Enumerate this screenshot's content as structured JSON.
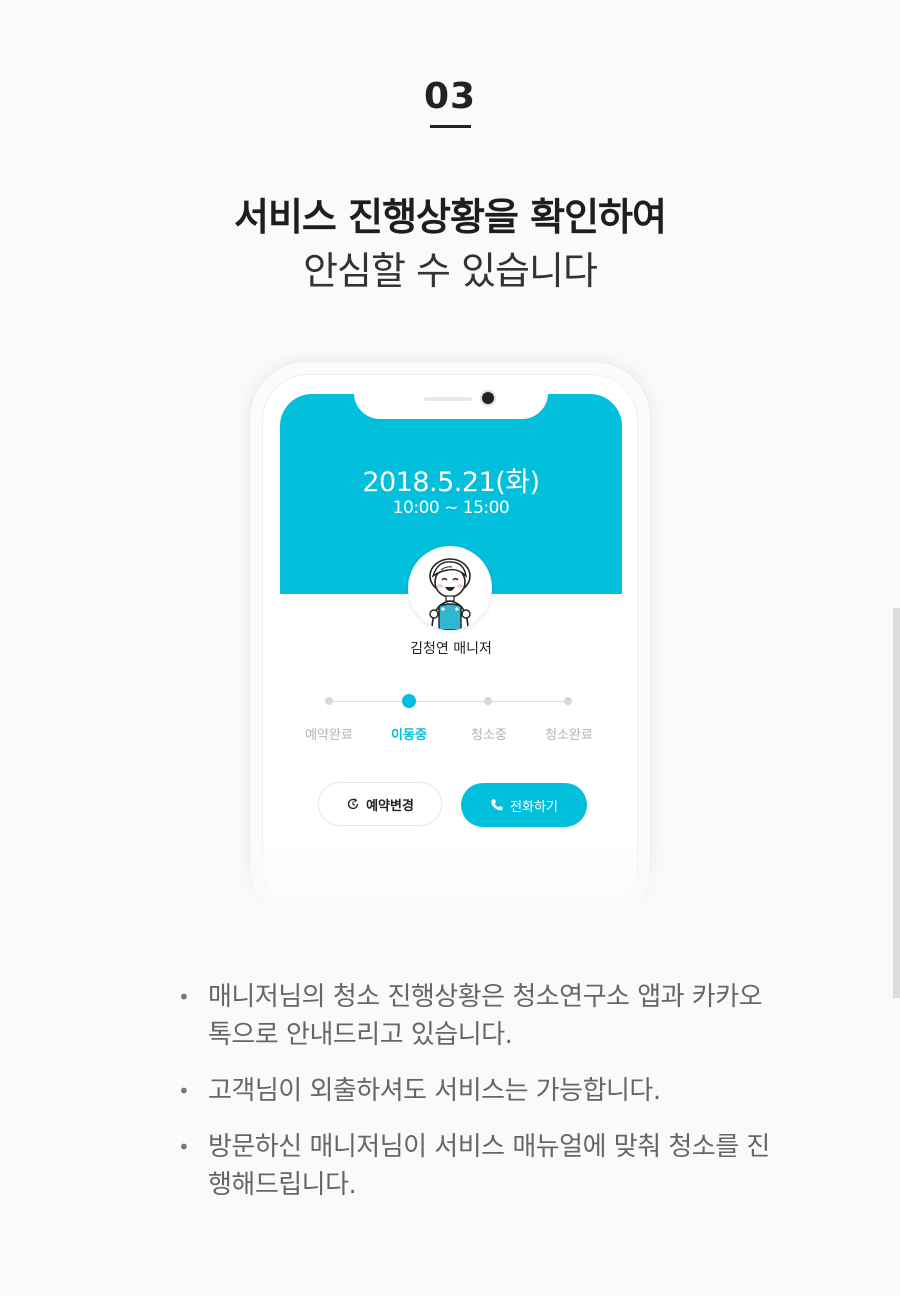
{
  "step": {
    "number": "03"
  },
  "heading": {
    "title": "서비스 진행상황을 확인하여",
    "subtitle": "안심할 수 있습니다"
  },
  "phone": {
    "date": "2018.5.21(화)",
    "time": "10:00 ~ 15:00",
    "manager_name": "김청연 매니저",
    "progress": {
      "steps": [
        "예약완료",
        "이동중",
        "청소중",
        "청소완료"
      ],
      "active_index": 1
    },
    "buttons": {
      "change_label": "예약변경",
      "call_label": "전화하기"
    },
    "colors": {
      "accent": "#02bfdc"
    }
  },
  "notes": [
    "매니저님의 청소 진행상황은 청소연구소 앱과 카카오톡으로 안내드리고 있습니다.",
    "고객님이 외출하셔도 서비스는 가능합니다.",
    "방문하신 매니저님이 서비스 매뉴얼에 맞춰 청소를 진행해드립니다."
  ]
}
